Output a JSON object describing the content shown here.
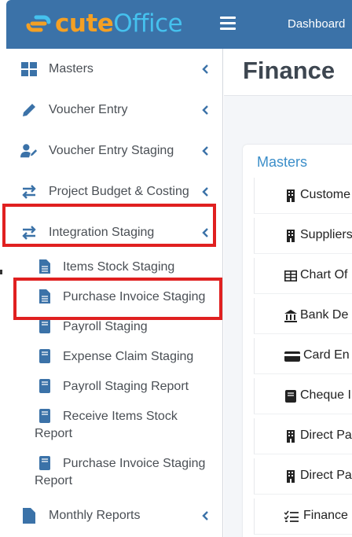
{
  "app": {
    "logo_part1": "cute",
    "logo_part2": "Office",
    "top_nav_item": "Dashboard"
  },
  "sidebar": {
    "items": [
      {
        "label": "Masters",
        "icon": "grid-icon"
      },
      {
        "label": "Voucher Entry",
        "icon": "pencil-icon"
      },
      {
        "label": "Voucher Entry Staging",
        "icon": "user-edit-icon"
      },
      {
        "label": "Project Budget & Costing",
        "icon": "exchange-icon"
      },
      {
        "label": "Integration Staging",
        "icon": "exchange-icon",
        "expanded": true
      }
    ],
    "sub_items": [
      {
        "label": "Items Stock Staging"
      },
      {
        "label": "Purchase Invoice Staging"
      },
      {
        "label": "Payroll Staging"
      },
      {
        "label": "Expense Claim Staging"
      },
      {
        "label": "Payroll Staging Report"
      },
      {
        "label_line1": "Receive Items Stock",
        "label_line2": "Report"
      },
      {
        "label_line1": "Purchase Invoice Staging",
        "label_line2": "Report"
      }
    ],
    "bottom_item": {
      "label": "Monthly Reports",
      "icon": "file-icon"
    }
  },
  "main": {
    "page_title": "Finance",
    "card_title": "Masters",
    "rows": [
      {
        "label": "Custome",
        "icon": "building-icon"
      },
      {
        "label": "Suppliers",
        "icon": "building-icon"
      },
      {
        "label": "Chart Of",
        "icon": "table-icon"
      },
      {
        "label": "Bank De",
        "icon": "bank-icon"
      },
      {
        "label": "Card En",
        "icon": "credit-card-icon"
      },
      {
        "label": "Cheque I",
        "icon": "book-icon"
      },
      {
        "label": "Direct Pa",
        "icon": "building-icon"
      },
      {
        "label": "Direct Pa",
        "icon": "building-icon"
      },
      {
        "label": "Finance",
        "icon": "checklist-icon"
      }
    ]
  },
  "colors": {
    "topbar": "#3b72a8",
    "logo_orange": "#f4a024",
    "logo_blue": "#45c1ee",
    "icon_blue": "#3b72a8",
    "highlight_red": "#e02020",
    "link_blue": "#3b8ec9"
  }
}
